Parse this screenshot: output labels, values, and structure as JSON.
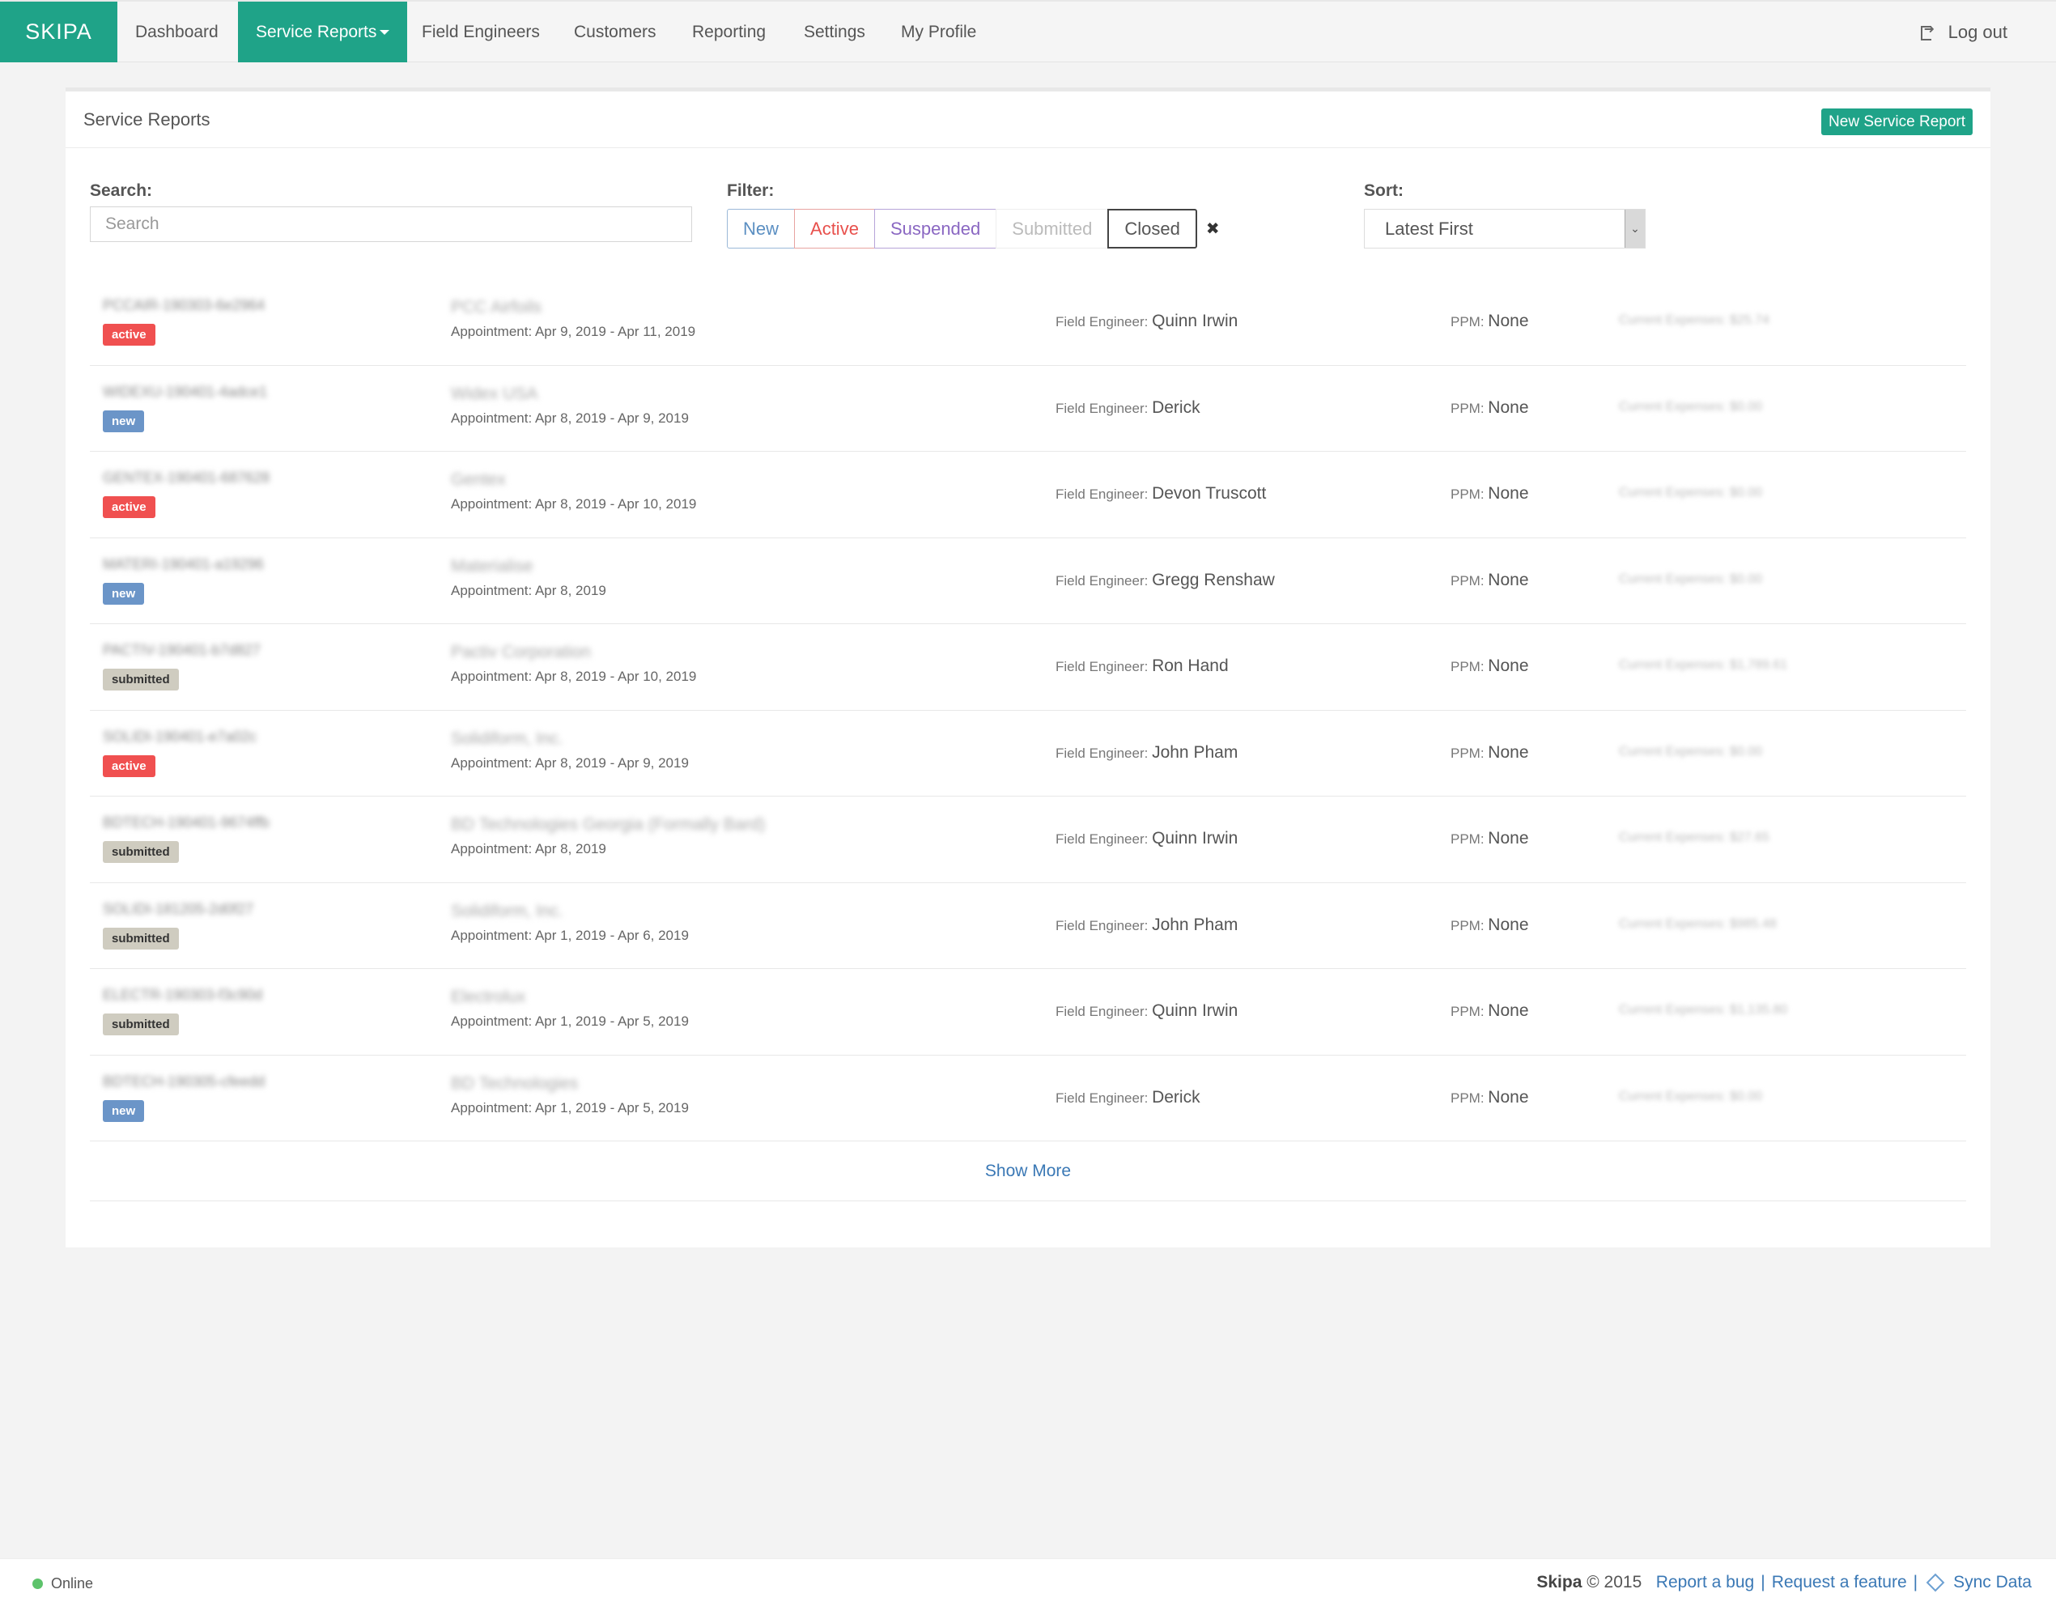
{
  "nav": {
    "brand": "SKIPA",
    "items": [
      {
        "label": "Dashboard"
      },
      {
        "label": "Service Reports"
      },
      {
        "label": "Field Engineers"
      },
      {
        "label": "Customers"
      },
      {
        "label": "Reporting"
      },
      {
        "label": "Settings"
      },
      {
        "label": "My Profile"
      }
    ],
    "logout": "Log out"
  },
  "panel": {
    "title": "Service Reports",
    "new_button": "New Service Report",
    "search_label": "Search:",
    "search_placeholder": "Search",
    "filter_label": "Filter:",
    "filters": [
      "New",
      "Active",
      "Suspended",
      "Submitted",
      "Closed"
    ],
    "clear_icon": "✖",
    "sort_label": "Sort:",
    "sort_value": "Latest First",
    "show_more": "Show More"
  },
  "rows": [
    {
      "ref": "PCCAIR-190303-6e2964",
      "status": "active",
      "customer": "PCC Airfoils",
      "appointment": "Appointment: Apr 9, 2019 - Apr 11, 2019",
      "engineer_label": "Field Engineer:",
      "engineer": "Quinn Irwin",
      "ppm_label": "PPM:",
      "ppm": "None",
      "expenses": "Current Expenses: $25.74"
    },
    {
      "ref": "WIDEXU-190401-4adce1",
      "status": "new",
      "customer": "Widex USA",
      "appointment": "Appointment: Apr 8, 2019 - Apr 9, 2019",
      "engineer_label": "Field Engineer:",
      "engineer": "Derick",
      "ppm_label": "PPM:",
      "ppm": "None",
      "expenses": "Current Expenses: $0.00"
    },
    {
      "ref": "GENTEX-190401-687628",
      "status": "active",
      "customer": "Gentex",
      "appointment": "Appointment: Apr 8, 2019 - Apr 10, 2019",
      "engineer_label": "Field Engineer:",
      "engineer": "Devon Truscott",
      "ppm_label": "PPM:",
      "ppm": "None",
      "expenses": "Current Expenses: $0.00"
    },
    {
      "ref": "MATERI-190401-a19296",
      "status": "new",
      "customer": "Materialise",
      "appointment": "Appointment: Apr 8, 2019",
      "engineer_label": "Field Engineer:",
      "engineer": "Gregg Renshaw",
      "ppm_label": "PPM:",
      "ppm": "None",
      "expenses": "Current Expenses: $0.00"
    },
    {
      "ref": "PACTIV-190401-b7d827",
      "status": "submitted",
      "customer": "Pactiv Corporation",
      "appointment": "Appointment: Apr 8, 2019 - Apr 10, 2019",
      "engineer_label": "Field Engineer:",
      "engineer": "Ron Hand",
      "ppm_label": "PPM:",
      "ppm": "None",
      "expenses": "Current Expenses: $1,789.61"
    },
    {
      "ref": "SOLIDI-190401-e7a02c",
      "status": "active",
      "customer": "Solidiform, Inc.",
      "appointment": "Appointment: Apr 8, 2019 - Apr 9, 2019",
      "engineer_label": "Field Engineer:",
      "engineer": "John Pham",
      "ppm_label": "PPM:",
      "ppm": "None",
      "expenses": "Current Expenses: $0.00"
    },
    {
      "ref": "BDTECH-190401-9674ffb",
      "status": "submitted",
      "customer": "BD Technologies Georgia (Formally Bard)",
      "appointment": "Appointment: Apr 8, 2019",
      "engineer_label": "Field Engineer:",
      "engineer": "Quinn Irwin",
      "ppm_label": "PPM:",
      "ppm": "None",
      "expenses": "Current Expenses: $27.65"
    },
    {
      "ref": "SOLIDI-181205-2d0f27",
      "status": "submitted",
      "customer": "Solidiform, Inc.",
      "appointment": "Appointment: Apr 1, 2019 - Apr 6, 2019",
      "engineer_label": "Field Engineer:",
      "engineer": "John Pham",
      "ppm_label": "PPM:",
      "ppm": "None",
      "expenses": "Current Expenses: $985.48"
    },
    {
      "ref": "ELECTR-190303-f3c90d",
      "status": "submitted",
      "customer": "Electrolux",
      "appointment": "Appointment: Apr 1, 2019 - Apr 5, 2019",
      "engineer_label": "Field Engineer:",
      "engineer": "Quinn Irwin",
      "ppm_label": "PPM:",
      "ppm": "None",
      "expenses": "Current Expenses: $1,135.80"
    },
    {
      "ref": "BDTECH-190305-cfeedd",
      "status": "new",
      "customer": "BD Technologies",
      "appointment": "Appointment: Apr 1, 2019 - Apr 5, 2019",
      "engineer_label": "Field Engineer:",
      "engineer": "Derick",
      "ppm_label": "PPM:",
      "ppm": "None",
      "expenses": "Current Expenses: $0.00"
    }
  ],
  "footer": {
    "status": "Online",
    "brand": "Skipa",
    "copyright": "© 2015",
    "report_bug": "Report a bug",
    "request_feature": "Request a feature",
    "sync": "Sync Data",
    "separator": "|"
  },
  "colors": {
    "brand": "#1fa388",
    "active": "#f05050",
    "new": "#6b95c8",
    "submitted": "#cfccc0",
    "link": "#3a78b5",
    "online": "#5dc36b"
  }
}
